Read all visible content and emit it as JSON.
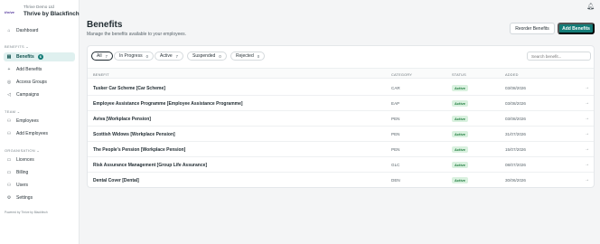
{
  "sidebar": {
    "logo_text": "thrive",
    "org_name": "Thrive Demo Ltd",
    "app_name": "Thrive by Blackfinch",
    "dashboard_label": "Dashboard",
    "benefits_section": "BENEFITS",
    "benefits_items": [
      {
        "label": "Benefits",
        "badge": "6"
      },
      {
        "label": "Add Benefits"
      },
      {
        "label": "Access Groups"
      },
      {
        "label": "Campaigns"
      }
    ],
    "team_section": "TEAM",
    "team_items": [
      {
        "label": "Employees"
      },
      {
        "label": "Add Employees"
      }
    ],
    "organisation_section": "ORGANISATION",
    "organisation_items": [
      {
        "label": "Licences"
      },
      {
        "label": "Billing"
      },
      {
        "label": "Users"
      },
      {
        "label": "Settings"
      }
    ],
    "powered_by": "Powered by Thrive by Blackfinch"
  },
  "header": {
    "title": "Benefits",
    "subtitle": "Manage the benefits available to your employees.",
    "reorder_label": "Reorder Benefits",
    "add_label": "Add Benefits"
  },
  "filters": [
    {
      "label": "All",
      "count": "7"
    },
    {
      "label": "In Progress",
      "count": "0"
    },
    {
      "label": "Active",
      "count": "7"
    },
    {
      "label": "Suspended",
      "count": "0"
    },
    {
      "label": "Rejected",
      "count": "0"
    }
  ],
  "search": {
    "placeholder": "Search benefit..."
  },
  "table": {
    "headers": {
      "benefit": "BENEFIT",
      "category": "CATEGORY",
      "status": "STATUS",
      "added": "ADDED"
    },
    "rows": [
      {
        "name": "Tusker Car Scheme [Car Scheme]",
        "category": "CAR",
        "status": "Active",
        "added": "03/08/2026"
      },
      {
        "name": "Employee Assistance Programme [Employee Assistance Programme]",
        "category": "EAP",
        "status": "Active",
        "added": "03/08/2026"
      },
      {
        "name": "Aviva [Workplace Pension]",
        "category": "PEN",
        "status": "Active",
        "added": "03/08/2026"
      },
      {
        "name": "Scottish Widows [Workplace Pension]",
        "category": "PEN",
        "status": "Active",
        "added": "31/07/2026"
      },
      {
        "name": "The People's Pension [Workplace Pension]",
        "category": "PEN",
        "status": "Active",
        "added": "15/07/2026"
      },
      {
        "name": "Risk Assurance Management [Group Life Assurance]",
        "category": "GLC",
        "status": "Active",
        "added": "08/07/2026"
      },
      {
        "name": "Dental Cover [Dental]",
        "category": "DEN",
        "status": "Active",
        "added": "30/06/2026"
      }
    ]
  },
  "colors": {
    "accent": "#137c77",
    "active_nav_bg": "#dff0ef",
    "status_bg": "#d9f1df",
    "status_text": "#1c7a3b"
  },
  "icons": {
    "bell": "bell-icon",
    "row_arrow": "arrow-right-icon"
  }
}
